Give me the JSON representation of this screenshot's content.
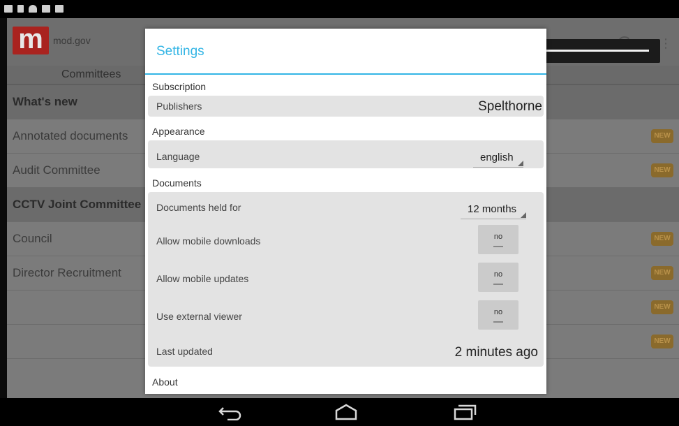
{
  "status_icons": [
    "image-icon",
    "sd-card-icon",
    "cloud-icon",
    "checkbox-icon",
    "checkbox-icon"
  ],
  "app": {
    "logo_letter": "m",
    "name": "mod.gov",
    "tab": "Committees"
  },
  "background_list": [
    {
      "label": "What's new",
      "header": true,
      "new": false
    },
    {
      "label": "Annotated documents",
      "header": false,
      "new": true
    },
    {
      "label": "Audit Committee",
      "header": false,
      "new": true
    },
    {
      "label": "CCTV Joint Committee",
      "header": true,
      "new": false
    },
    {
      "label": "Council",
      "header": false,
      "new": true
    },
    {
      "label": "Director Recruitment",
      "header": false,
      "new": true
    },
    {
      "label": "",
      "header": false,
      "new": true
    },
    {
      "label": "",
      "header": false,
      "new": true
    }
  ],
  "new_badge": "NEW",
  "dialog": {
    "title": "Settings",
    "sections": {
      "subscription": "Subscription",
      "appearance": "Appearance",
      "documents": "Documents",
      "about": "About"
    },
    "publishers": {
      "label": "Publishers",
      "value": "Spelthorne"
    },
    "language": {
      "label": "Language",
      "value": "english"
    },
    "documents_held_for": {
      "label": "Documents held for",
      "value": "12 months"
    },
    "allow_mobile_downloads": {
      "label": "Allow mobile downloads",
      "value": "no"
    },
    "allow_mobile_updates": {
      "label": "Allow mobile updates",
      "value": "no"
    },
    "use_external_viewer": {
      "label": "Use external viewer",
      "value": "no"
    },
    "last_updated": {
      "label": "Last updated",
      "value": "2 minutes ago"
    }
  },
  "colors": {
    "accent": "#33b5e5",
    "brand": "#a9231f",
    "badge": "#8a6a2c"
  },
  "nav": [
    "back-icon",
    "home-icon",
    "recents-icon"
  ]
}
